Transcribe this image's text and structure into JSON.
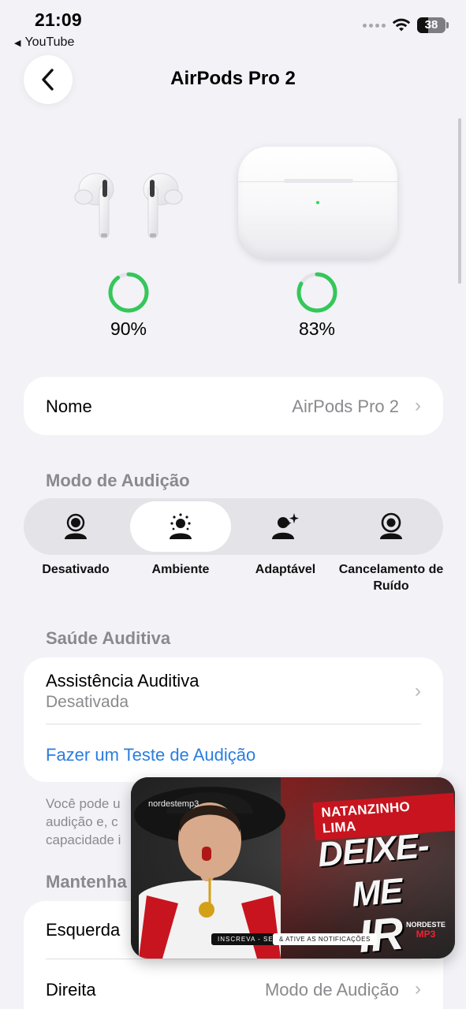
{
  "status_bar": {
    "time": "21:09",
    "back_app": "YouTube",
    "battery": "38"
  },
  "nav": {
    "title": "AirPods Pro 2"
  },
  "devices": {
    "buds_battery": "90%",
    "buds_level": 0.9,
    "case_battery": "83%",
    "case_level": 0.83,
    "ring_color": "#34c759"
  },
  "name_row": {
    "label": "Nome",
    "value": "AirPods Pro 2"
  },
  "listening_mode": {
    "section_title": "Modo de Audição",
    "options": [
      {
        "label": "Desativado",
        "icon": "person-off-icon"
      },
      {
        "label": "Ambiente",
        "icon": "person-ambient-icon",
        "selected": true
      },
      {
        "label": "Adaptável",
        "icon": "person-adaptive-icon"
      },
      {
        "label": "Cancelamento de Ruído",
        "icon": "person-noise-cancel-icon"
      }
    ]
  },
  "hearing_health": {
    "section_title": "Saúde Auditiva",
    "assist_label": "Assistência Auditiva",
    "assist_value": "Desativada",
    "test_link": "Fazer um Teste de Audição",
    "footnote_lines": [
      "Você pode u",
      "audição e, c",
      "capacidade i"
    ]
  },
  "hold": {
    "section_title": "Mantenha",
    "left_label": "Esquerda",
    "right_label": "Direita",
    "right_value": "Modo de Audição"
  },
  "video": {
    "handle": "nordestemp3",
    "artist": "NATANZINHO LIMA",
    "title_line1": "DEIXE-ME",
    "title_line2": "IR",
    "subscribe": "INSCREVA - SE",
    "notify": "& ATIVE AS NOTIFICAÇÕES",
    "brand_line1": "NORDESTE",
    "brand_line2": "MP3"
  }
}
